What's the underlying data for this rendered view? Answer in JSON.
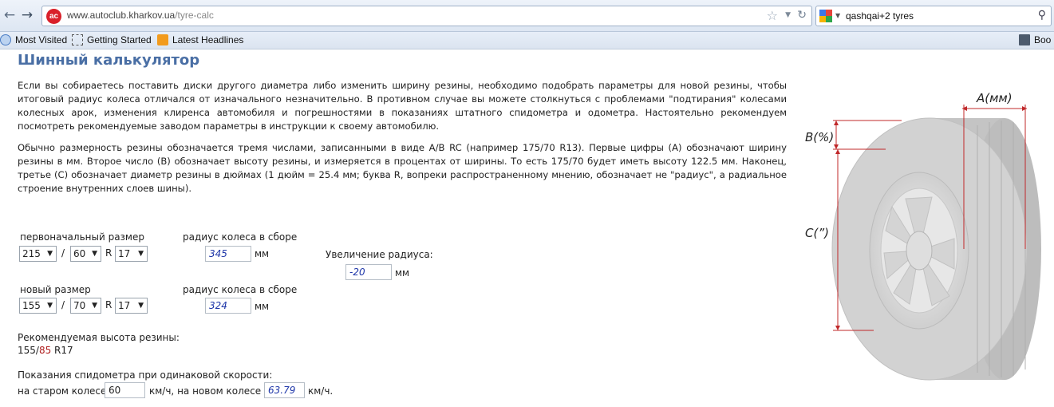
{
  "browser": {
    "url_host": "www.autoclub.kharkov.ua",
    "url_path": "/tyre-calc",
    "search_query": "qashqai+2 tyres"
  },
  "bookmarks": [
    {
      "label": "Most Visited",
      "icon": "most-visited-icon"
    },
    {
      "label": "Getting Started",
      "icon": "page-icon"
    },
    {
      "label": "Latest Headlines",
      "icon": "rss-icon"
    },
    {
      "label": "Boo",
      "icon": "bookmarks-icon"
    }
  ],
  "page": {
    "title": "Шинный калькулятор",
    "para1": "Если вы собираетесь поставить диски другого диаметра либо изменить ширину резины, необходимо подобрать параметры для новой резины, чтобы итоговый радиус колеса отличался от изначального незначительно. В противном случае вы можете столкнуться с проблемами \"подтирания\" колесами колесных арок, изменения клиренса автомобиля и погрешностями в показаниях штатного спидометра и одометра. Настоятельно рекомендуем посмотреть рекомендуемые заводом параметры в инструкции к своему автомобилю.",
    "para2": "Обычно размерность резины обозначается тремя числами, записанными в виде A/B RC (например 175/70 R13). Первые цифры (A) обозначают ширину резины в мм. Второе число (B) обозначает высоту резины, и измеряется в процентах от ширины. То есть 175/70 будет иметь высоту 122.5 мм. Наконец, третье (C) обозначает диаметр резины в дюймах (1 дюйм = 25.4 мм; буква R, вопреки распространенному мнению, обозначает не \"радиус\", а радиальное строение внутренних слоев шины)."
  },
  "calc": {
    "original_label": "первоначальный размер",
    "new_label": "новый размер",
    "radius_label": "радиус колеса в сборе",
    "increase_label": "Увеличение радиуса:",
    "unit_mm": "мм",
    "slash": "/",
    "r": "R",
    "original": {
      "width": "215",
      "profile": "60",
      "diameter": "17",
      "radius": "345"
    },
    "new": {
      "width": "155",
      "profile": "70",
      "diameter": "17",
      "radius": "324"
    },
    "increase": "-20",
    "recommended_label": "Рекомендуемая высота резины:",
    "recommended_a": "155/",
    "recommended_b": "85",
    "recommended_c": " R17",
    "speed_label": "Показания спидометра при одинаковой скорости:",
    "old_wheel_label": "на старом колесе",
    "old_speed": "60",
    "kmh_new": "км/ч, на новом колесе",
    "new_speed": "63.79",
    "kmh": "км/ч."
  },
  "figure": {
    "label_a": "A(мм)",
    "label_b": "B(%)",
    "label_c": "C(”)"
  },
  "colors": {
    "title": "#4a6fa5",
    "dimension_lines": "#c0282a",
    "value_text": "#1d35a8"
  }
}
